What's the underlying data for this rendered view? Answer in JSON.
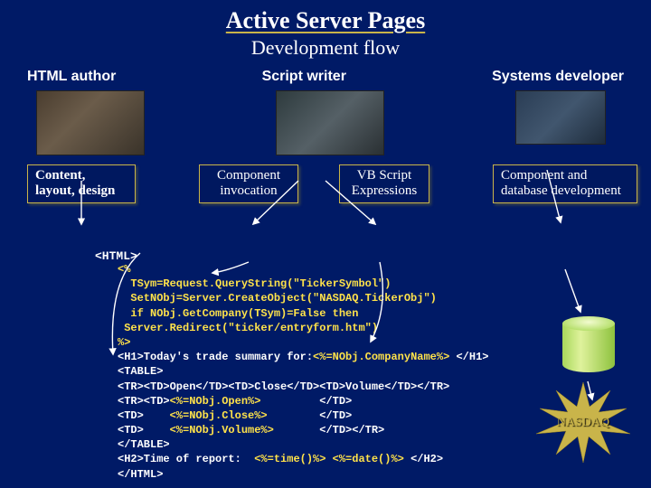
{
  "header": {
    "title": "Active Server Pages",
    "subtitle": "Development flow"
  },
  "roles": {
    "html_author": "HTML author",
    "script_writer": "Script writer",
    "systems_developer": "Systems developer"
  },
  "boxes": {
    "content_layout": "Content, layout, design",
    "component_invocation": "Component invocation",
    "vb_script": "VB Script Expressions",
    "component_db": "Component and database development"
  },
  "html_tag": "<HTML>",
  "code": {
    "l1": "<%",
    "l2": "  TSym=Request.QueryString(\"TickerSymbol\")",
    "l3": "  SetNObj=Server.CreateObject(\"NASDAQ.TickerObj\")",
    "l4": "  if NObj.GetCompany(TSym)=False then",
    "l5": " Server.Redirect(\"ticker/entryform.htm\")",
    "l6": "%>",
    "l7a": "<H1>Today's trade summary for:",
    "l7b": "<%=NObj.CompanyName%>",
    "l7c": " </H1>",
    "l8": "<TABLE>",
    "l9": "<TR><TD>Open</TD><TD>Close</TD><TD>Volume</TD></TR>",
    "l10a": "<TR><TD>",
    "l10b": "<%=NObj.Open%>",
    "l10c": "         </TD>",
    "l11a": "<TD>    ",
    "l11b": "<%=NObj.Close%>",
    "l11c": "        </TD>",
    "l12a": "<TD>    ",
    "l12b": "<%=NObj.Volume%>",
    "l12c": "       </TD></TR>",
    "l13": "</TABLE>",
    "l14a": "<H2>Time of report:  ",
    "l14b": "<%=time()%> <%=date()%>",
    "l14c": " </H2>",
    "l15": "</HTML>"
  },
  "db": {
    "label": "NASDAQ"
  },
  "colors": {
    "accent": "#c9b44a",
    "bg": "#001a66",
    "code_highlight": "#ffe24a"
  }
}
